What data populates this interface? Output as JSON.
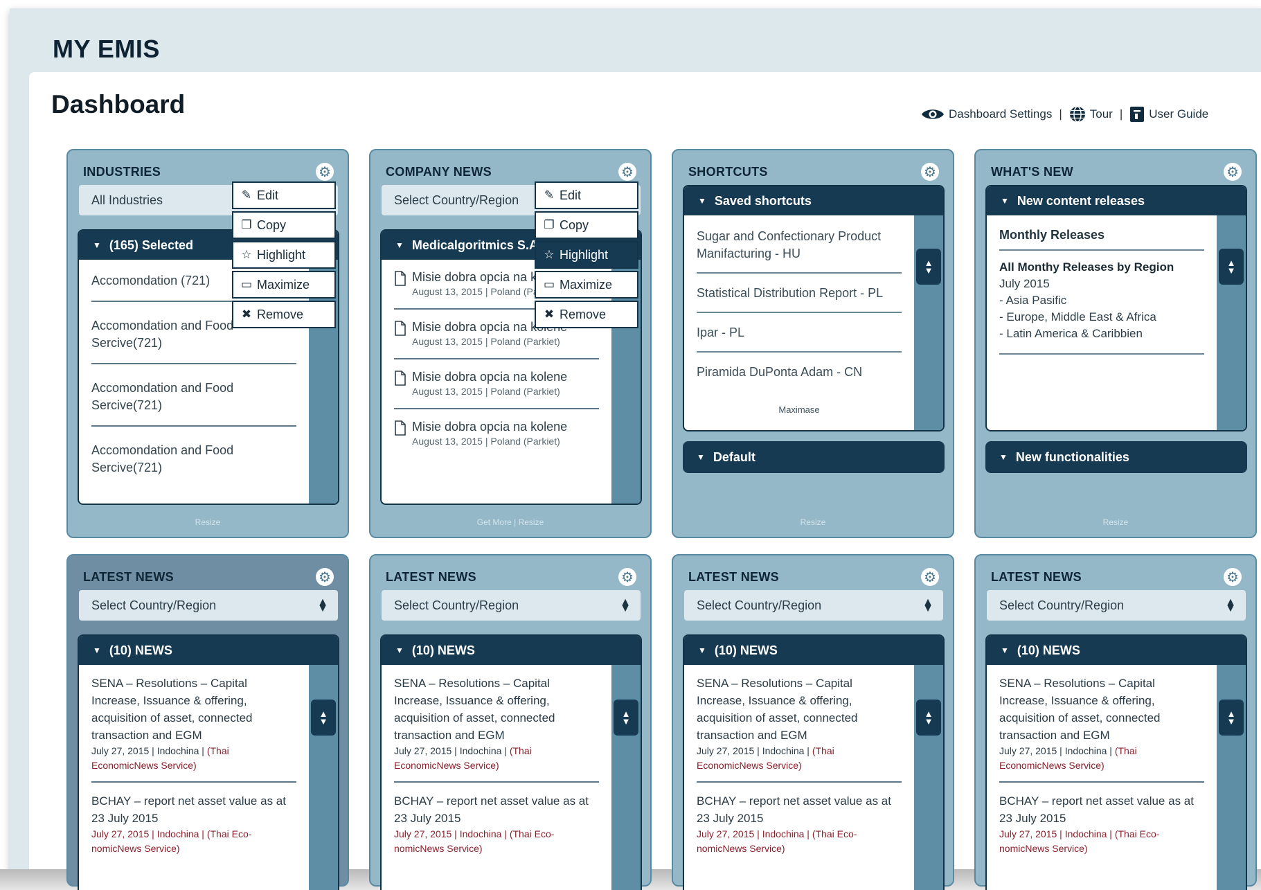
{
  "app": {
    "title": "MY EMIS"
  },
  "page": {
    "title": "Dashboard"
  },
  "toolbar": {
    "settings_label": "Dashboard Settings",
    "tour_label": "Tour",
    "guide_label": "User Guide",
    "separator": "|",
    "icons": [
      "eye-icon",
      "globe-icon",
      "book-icon"
    ]
  },
  "context_menu": {
    "items": [
      {
        "label": "Edit",
        "icon": "pencil-icon"
      },
      {
        "label": "Copy",
        "icon": "copy-icon"
      },
      {
        "label": "Highlight",
        "icon": "star-icon"
      },
      {
        "label": "Maximize",
        "icon": "window-icon"
      },
      {
        "label": "Remove",
        "icon": "x-icon"
      }
    ]
  },
  "industries": {
    "title": "INDUSTRIES",
    "select_value": "All Industries",
    "panel_title": "(165) Selected",
    "items": [
      "Accomondation (721)",
      "Accomondation and Food Sercive(721)",
      "Accomondation and Food Sercive(721)",
      "Accomondation and Food Sercive(721)"
    ],
    "footer": "Resize"
  },
  "company_news": {
    "title": "COMPANY NEWS",
    "select_value": "Select Country/Region",
    "panel_title": "Medicalgoritmics S.A.",
    "items": [
      {
        "title": "Misie dobra opcia na kolene",
        "meta": "August 13, 2015 | Poland (Parkiet)"
      },
      {
        "title": "Misie dobra opcia na kolene",
        "meta": "August 13, 2015 | Poland (Parkiet)"
      },
      {
        "title": "Misie dobra opcia na kolene",
        "meta": "August 13, 2015 | Poland (Parkiet)"
      },
      {
        "title": "Misie dobra opcia na kolene",
        "meta": "August 13, 2015 | Poland (Parkiet)"
      }
    ],
    "footer_more": "Get More",
    "footer_sep": "|",
    "footer_resize": "Resize"
  },
  "shortcuts": {
    "title": "SHORTCUTS",
    "panel_title": "Saved shortcuts",
    "items": [
      "Sugar and Confectionary Product Manifacturing - HU",
      "Statistical Distribution Report - PL",
      "Ipar - PL",
      "Piramida DuPonta  Adam - CN"
    ],
    "maximise": "Maximase",
    "default_label": "Default",
    "footer": "Resize"
  },
  "whats_new": {
    "title": "WHAT'S NEW",
    "panel_title": "New content releases",
    "monthly": "Monthly Releases",
    "block_title": "All Monthy Releases by Region",
    "block_date": "July 2015",
    "regions": [
      "- Asia Pasific",
      "- Europe, Middle East & Africa",
      "- Latin America & Caribbien"
    ],
    "functionalities": "New functionalities",
    "footer": "Resize"
  },
  "latest_news": {
    "title": "LATEST NEWS",
    "select_value": "Select Country/Region",
    "panel_title": "(10) NEWS",
    "items": [
      {
        "title": "SENA – Resolutions – Capital Increase, Issuance & offering, acquisition of asset, connected transaction and EGM",
        "meta_plain": "July 27, 2015 | Indochina | ",
        "meta_source": "(Thai EconomicNews Service)"
      },
      {
        "title": "BCHAY – report net asset value as at 23 July 2015",
        "meta_plain": "",
        "meta_source": "July 27, 2015 | Indochina | (Thai Eco-nomicNews Service)"
      }
    ]
  },
  "colors": {
    "frame_bg": "#dde8ed",
    "widget_bg": "#94b8c8",
    "widget_dark_bg": "#6f8da3",
    "panel_header": "#163a52",
    "scroll_rail": "#5e8ea6",
    "news_meta_red": "#8a1f2b"
  }
}
